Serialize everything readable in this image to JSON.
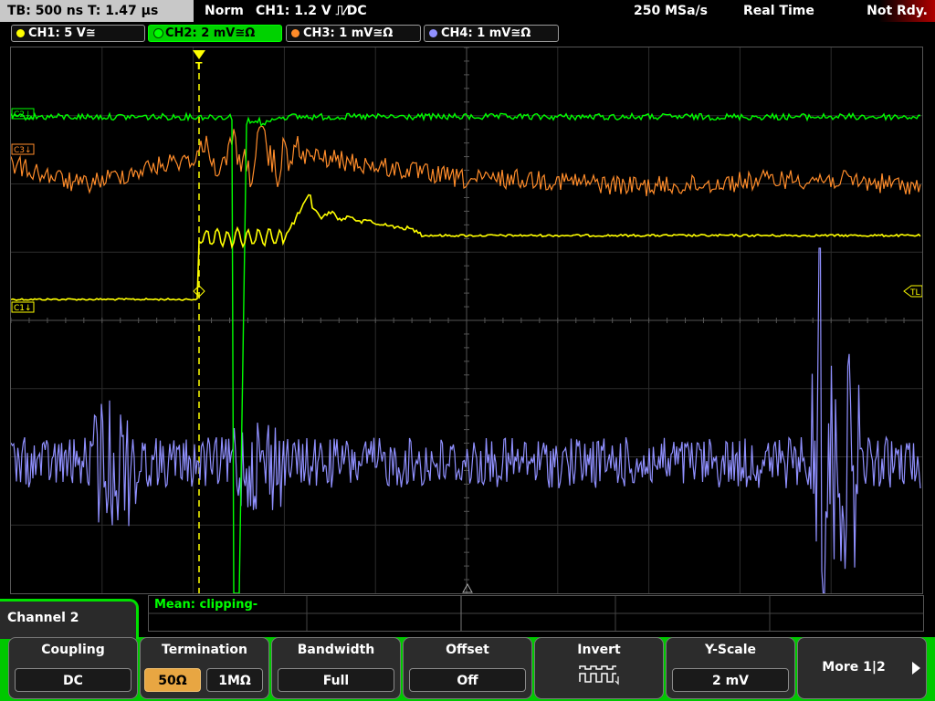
{
  "status_bar": {
    "timebase": "TB: 500 ns   T: 1.47 µs",
    "trigger_mode": "Norm",
    "trigger_info": "CH1: 1.2 V ⎍⁄DC",
    "sample_rate": "250 MSa/s",
    "acq_mode": "Real Time",
    "ready": "Not Rdy."
  },
  "channels": [
    {
      "label": "CH1: 5 V≅",
      "color": "#ffff00"
    },
    {
      "label": "CH2: 2 mV≅Ω",
      "color": "#00ff00"
    },
    {
      "label": "CH3: 1 mV≅Ω",
      "color": "#ff8c2a"
    },
    {
      "label": "CH4: 1 mV≅Ω",
      "color": "#9090ff"
    }
  ],
  "markers": {
    "c2": "C2↓",
    "c3": "C3↓",
    "c1": "C1↓",
    "tl": "TL",
    "trigger": "T"
  },
  "measurement": "Mean: clipping-",
  "menu": {
    "channel_title": "Channel 2",
    "softkeys": {
      "coupling": {
        "title": "Coupling",
        "value": "DC"
      },
      "termination": {
        "title": "Termination",
        "opt1": "50Ω",
        "opt2": "1MΩ"
      },
      "bandwidth": {
        "title": "Bandwidth",
        "value": "Full"
      },
      "offset": {
        "title": "Offset",
        "value": "Off"
      },
      "invert": {
        "title": "Invert"
      },
      "yscale": {
        "title": "Y-Scale",
        "value": "2 mV"
      },
      "more": {
        "label": "More 1|2"
      }
    }
  },
  "colors": {
    "ch1": "#ffff00",
    "ch2": "#00ff00",
    "ch3": "#ff8c2a",
    "ch4": "#9090ff",
    "menu_accent": "#00c800",
    "selected": "#e8a642"
  },
  "icons": [
    "square-wave-invert-icon",
    "arrow-right-icon"
  ]
}
